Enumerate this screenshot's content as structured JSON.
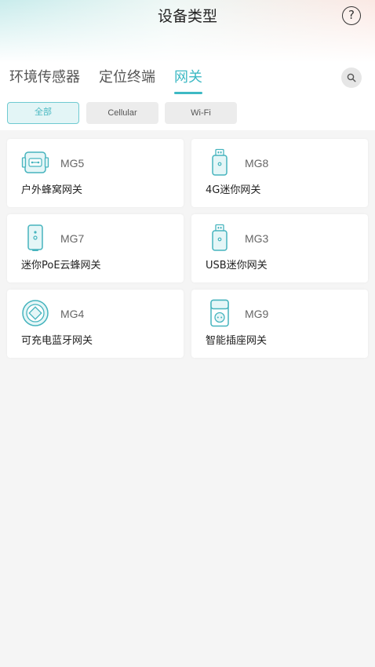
{
  "header": {
    "title": "设备类型",
    "help_icon": "question-circle-icon",
    "help_glyph": "?"
  },
  "tabs": [
    {
      "label": "环境传感器",
      "active": false
    },
    {
      "label": "定位终端",
      "active": false
    },
    {
      "label": "网关",
      "active": true
    }
  ],
  "search": {
    "icon": "search-icon"
  },
  "filters": [
    {
      "label": "全部",
      "active": true
    },
    {
      "label": "Cellular",
      "active": false
    },
    {
      "label": "Wi-Fi",
      "active": false
    }
  ],
  "devices": [
    {
      "model": "MG5",
      "name": "户外蜂窝网关",
      "icon": "outdoor-gateway-icon"
    },
    {
      "model": "MG8",
      "name": "4G迷你网关",
      "icon": "usb-dongle-icon"
    },
    {
      "model": "MG7",
      "name": "迷你PoE云蜂网关",
      "icon": "mini-poe-gateway-icon"
    },
    {
      "model": "MG3",
      "name": "USB迷你网关",
      "icon": "usb-dongle-icon"
    },
    {
      "model": "MG4",
      "name": "可充电蓝牙网关",
      "icon": "round-gateway-icon"
    },
    {
      "model": "MG9",
      "name": "智能插座网关",
      "icon": "smart-plug-icon"
    }
  ],
  "colors": {
    "accent": "#3db9c4",
    "icon_stroke": "#46b4be",
    "icon_fill": "#e5f6f7",
    "background": "#f5f5f5"
  }
}
